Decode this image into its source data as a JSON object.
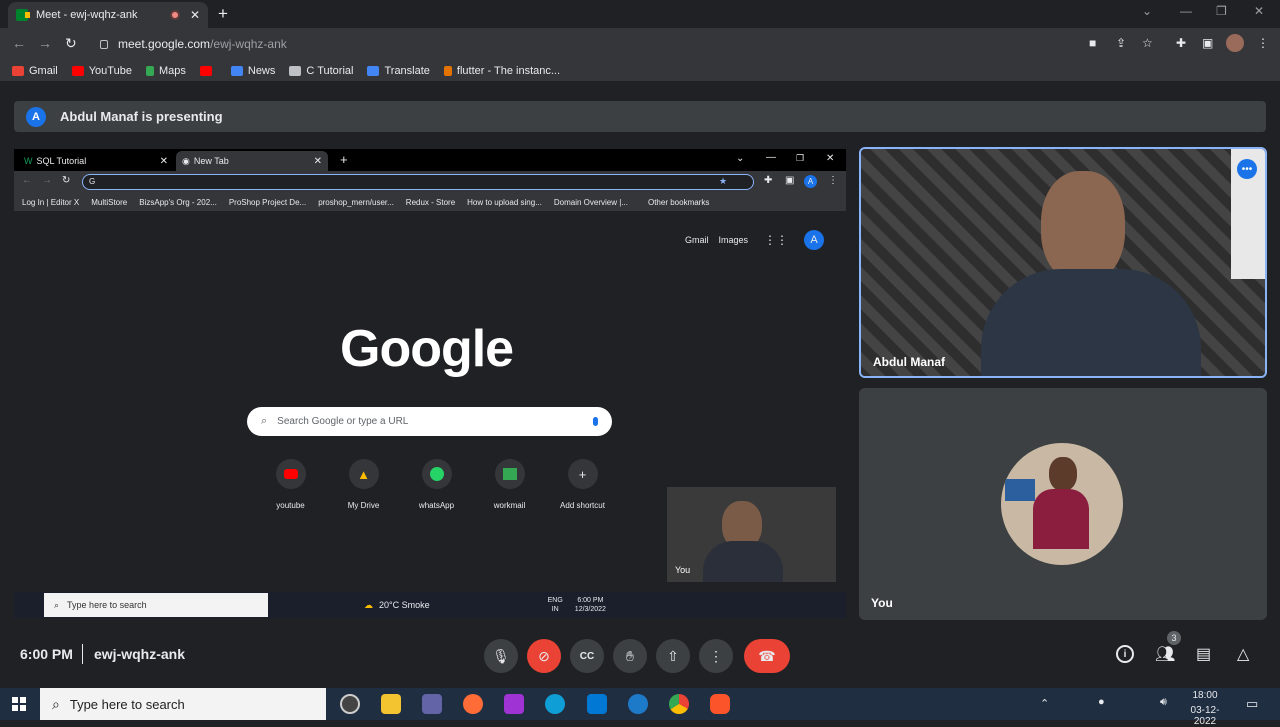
{
  "browser": {
    "tab_title": "Meet - ewj-wqhz-ank",
    "url_host": "meet.google.com",
    "url_path": "/ewj-wqhz-ank",
    "bookmarks": [
      "Gmail",
      "YouTube",
      "Maps",
      "",
      "News",
      "C Tutorial",
      "Translate",
      "flutter - The instanc..."
    ]
  },
  "meet": {
    "presenting_banner": "Abdul Manaf is presenting",
    "avatar_letter": "A",
    "presenter_name": "Abdul Manaf",
    "self_name": "You",
    "time": "6:00 PM",
    "meeting_code": "ewj-wqhz-ank",
    "participants_count": "3"
  },
  "shared_screen": {
    "tabs": [
      "SQL Tutorial",
      "New Tab"
    ],
    "bookmarks": [
      "Log In | Editor X",
      "MultiStore",
      "BizsApp's Org - 202...",
      "ProShop Project De...",
      "proshop_mern/user...",
      "Redux - Store",
      "How to upload sing...",
      "Domain Overview |...",
      "Other bookmarks"
    ],
    "top_links": [
      "Gmail",
      "Images"
    ],
    "avatar_letter": "A",
    "logo": "Google",
    "search_placeholder": "Search Google or type a URL",
    "shortcuts": [
      "youtube",
      "My Drive",
      "whatsApp",
      "workmail",
      "Add shortcut"
    ],
    "pip_label": "You",
    "taskbar_search": "Type here to search",
    "weather": "20°C Smoke",
    "lang": "ENG",
    "lang2": "IN",
    "clock_time": "6:00 PM",
    "clock_date": "12/3/2022"
  },
  "taskbar": {
    "search_placeholder": "Type here to search",
    "time": "18:00",
    "date": "03-12-2022"
  },
  "colors": {
    "end_call": "#ea4335",
    "accent_blue": "#8ab4f8",
    "meet_bg": "#202124"
  }
}
